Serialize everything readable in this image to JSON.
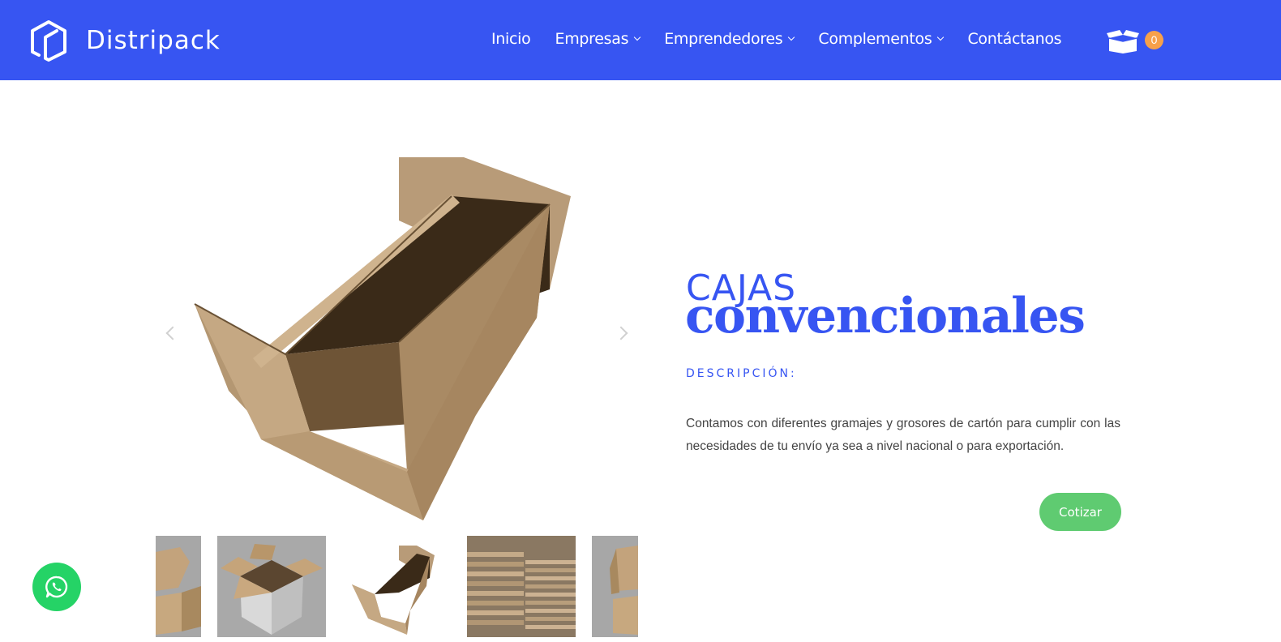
{
  "brand": {
    "name": "Distripack",
    "color": "#3755f2"
  },
  "nav": {
    "items": [
      {
        "label": "Inicio",
        "dropdown": false
      },
      {
        "label": "Empresas",
        "dropdown": true
      },
      {
        "label": "Emprendedores",
        "dropdown": true
      },
      {
        "label": "Complementos",
        "dropdown": true
      },
      {
        "label": "Contáctanos",
        "dropdown": false
      }
    ],
    "cart_count": "0",
    "cart_icon": "box-icon"
  },
  "product": {
    "title_light": "CAJAS",
    "title_bold": "convencionales",
    "description_label": "DESCRIPCIÓN:",
    "description": "Contamos con diferentes gramajes y grosores de cartón para cumplir con las necesidades de tu envío ya sea a nivel nacional o para exportación.",
    "cta_label": "Cotizar",
    "cta_color": "#5fcb71"
  },
  "gallery": {
    "thumbnail_count": 5,
    "prev_icon": "chevron-left-icon",
    "next_icon": "chevron-right-icon"
  },
  "whatsapp": {
    "icon": "whatsapp-icon",
    "color": "#25d366"
  }
}
